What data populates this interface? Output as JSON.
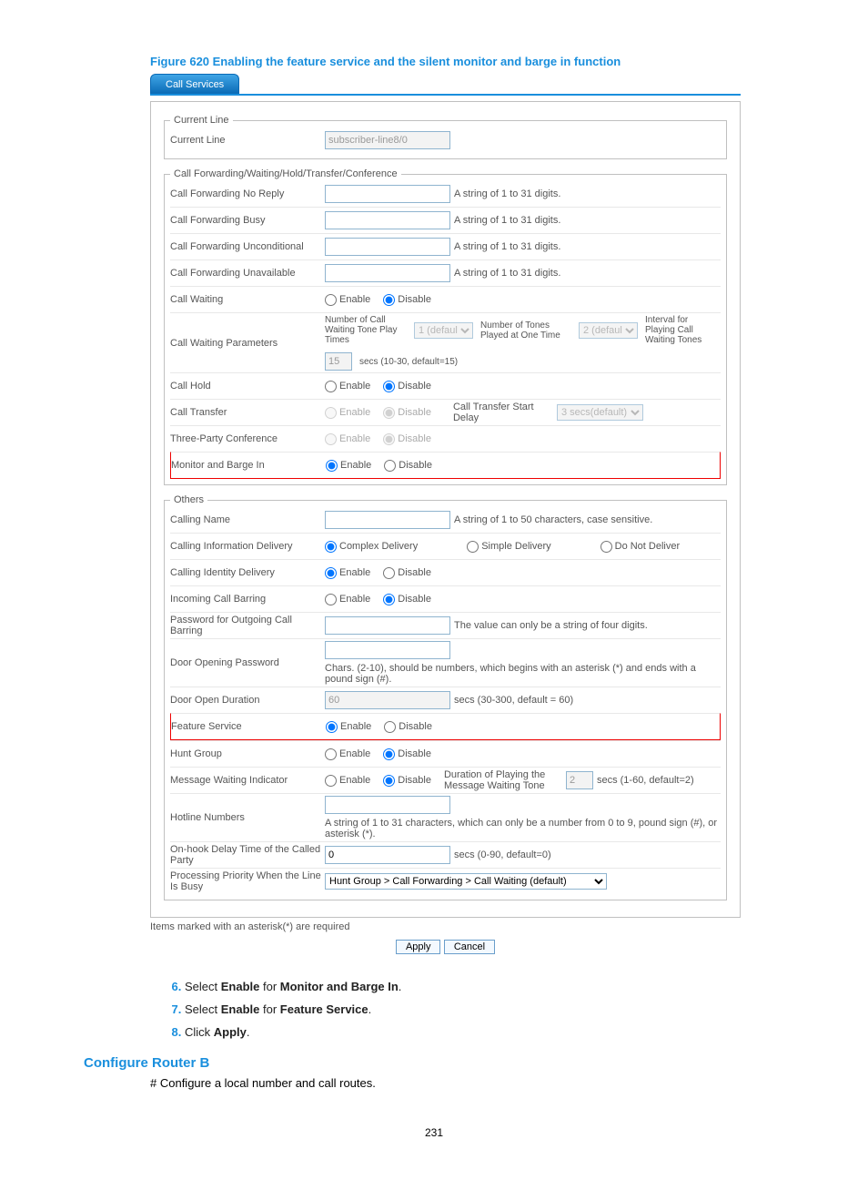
{
  "figure_title": "Figure 620 Enabling the feature service and the silent monitor and barge in function",
  "tab": "Call Services",
  "current_line": {
    "legend": "Current Line",
    "label": "Current Line",
    "value": "subscriber-line8/0"
  },
  "fwd": {
    "legend": "Call Forwarding/Waiting/Hold/Transfer/Conference",
    "no_reply": {
      "label": "Call Forwarding No Reply",
      "hint": "A string of 1 to 31 digits."
    },
    "busy": {
      "label": "Call Forwarding Busy",
      "hint": "A string of 1 to 31 digits."
    },
    "uncond": {
      "label": "Call Forwarding Unconditional",
      "hint": "A string of 1 to 31 digits."
    },
    "unavail": {
      "label": "Call Forwarding Unavailable",
      "hint": "A string of 1 to 31 digits."
    },
    "waiting": {
      "label": "Call Waiting",
      "enable": "Enable",
      "disable": "Disable"
    },
    "waiting_params": {
      "label": "Call Waiting Parameters",
      "play_label": "Number of Call Waiting Tone Play Times",
      "play_value": "1 (defaul",
      "tones_label": "Number of Tones Played at One Time",
      "tones_value": "2 (defaul",
      "interval_label": "Interval for Playing Call Waiting Tones",
      "interval_value": "15",
      "interval_hint": "secs (10-30, default=15)"
    },
    "hold": {
      "label": "Call Hold",
      "enable": "Enable",
      "disable": "Disable"
    },
    "transfer": {
      "label": "Call Transfer",
      "enable": "Enable",
      "disable": "Disable",
      "delay_label": "Call Transfer Start Delay",
      "delay_value": "3 secs(default)"
    },
    "conf": {
      "label": "Three-Party Conference",
      "enable": "Enable",
      "disable": "Disable"
    },
    "monitor": {
      "label": "Monitor and Barge In",
      "enable": "Enable",
      "disable": "Disable"
    }
  },
  "others": {
    "legend": "Others",
    "calling_name": {
      "label": "Calling Name",
      "hint": "A string of 1 to 50 characters, case sensitive."
    },
    "info_delivery": {
      "label": "Calling Information Delivery",
      "complex": "Complex Delivery",
      "simple": "Simple Delivery",
      "none": "Do Not Deliver"
    },
    "identity": {
      "label": "Calling Identity Delivery",
      "enable": "Enable",
      "disable": "Disable"
    },
    "incoming_bar": {
      "label": "Incoming Call Barring",
      "enable": "Enable",
      "disable": "Disable"
    },
    "out_pwd": {
      "label": "Password for Outgoing Call Barring",
      "hint": "The value can only be a string of four digits."
    },
    "door_pwd": {
      "label": "Door Opening Password",
      "hint": "Chars. (2-10), should be numbers, which begins with an asterisk (*) and ends with a pound sign (#)."
    },
    "door_dur": {
      "label": "Door Open Duration",
      "value": "60",
      "hint": "secs (30-300, default = 60)"
    },
    "feature": {
      "label": "Feature Service",
      "enable": "Enable",
      "disable": "Disable"
    },
    "hunt": {
      "label": "Hunt Group",
      "enable": "Enable",
      "disable": "Disable"
    },
    "mwi": {
      "label": "Message Waiting Indicator",
      "enable": "Enable",
      "disable": "Disable",
      "dur_label": "Duration of Playing the Message Waiting Tone",
      "dur_value": "2",
      "dur_hint": "secs (1-60, default=2)"
    },
    "hotline": {
      "label": "Hotline Numbers",
      "hint": "A string of 1 to 31 characters, which can only be a number from 0 to 9, pound sign (#), or asterisk (*)."
    },
    "onhook": {
      "label": "On-hook Delay Time of the Called Party",
      "value": "0",
      "hint": "secs (0-90, default=0)"
    },
    "priority": {
      "label": "Processing Priority When the Line Is Busy",
      "value": "Hunt Group > Call Forwarding > Call Waiting (default)"
    }
  },
  "footnote": "Items marked with an asterisk(*) are required",
  "buttons": {
    "apply": "Apply",
    "cancel": "Cancel"
  },
  "steps": {
    "s6_a": "Select ",
    "s6_b": "Enable",
    "s6_c": " for ",
    "s6_d": "Monitor and Barge In",
    "s6_e": ".",
    "s7_a": "Select ",
    "s7_b": "Enable",
    "s7_c": " for ",
    "s7_d": "Feature Service",
    "s7_e": ".",
    "s8_a": "Click ",
    "s8_b": "Apply",
    "s8_c": "."
  },
  "subhead": "Configure Router B",
  "body": "# Configure a local number and call routes.",
  "page": "231"
}
